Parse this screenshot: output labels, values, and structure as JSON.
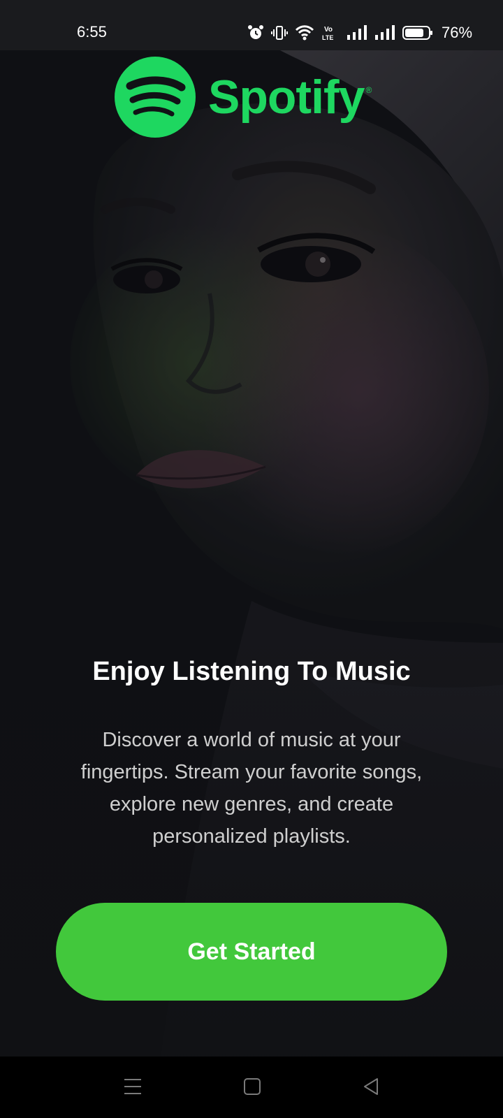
{
  "status_bar": {
    "time": "6:55",
    "battery_percent": "76%",
    "icons": [
      "alarm-icon",
      "vibrate-icon",
      "wifi-icon",
      "volte-icon",
      "signal-icon",
      "signal-icon",
      "battery-icon"
    ],
    "volte_label_top": "Vo",
    "volte_label_bottom": "LTE"
  },
  "brand": {
    "logo_text": "Spotify",
    "registered_mark": "®",
    "accent_color": "#1ed760"
  },
  "onboarding": {
    "headline": "Enjoy Listening To Music",
    "description": "Discover a world of music at your fingertips. Stream your favorite songs, explore new genres, and create personalized playlists.",
    "cta_label": "Get Started",
    "cta_color": "#42c83c"
  },
  "nav_bar": {
    "buttons": [
      "menu-icon",
      "home-square-icon",
      "back-triangle-icon"
    ]
  }
}
